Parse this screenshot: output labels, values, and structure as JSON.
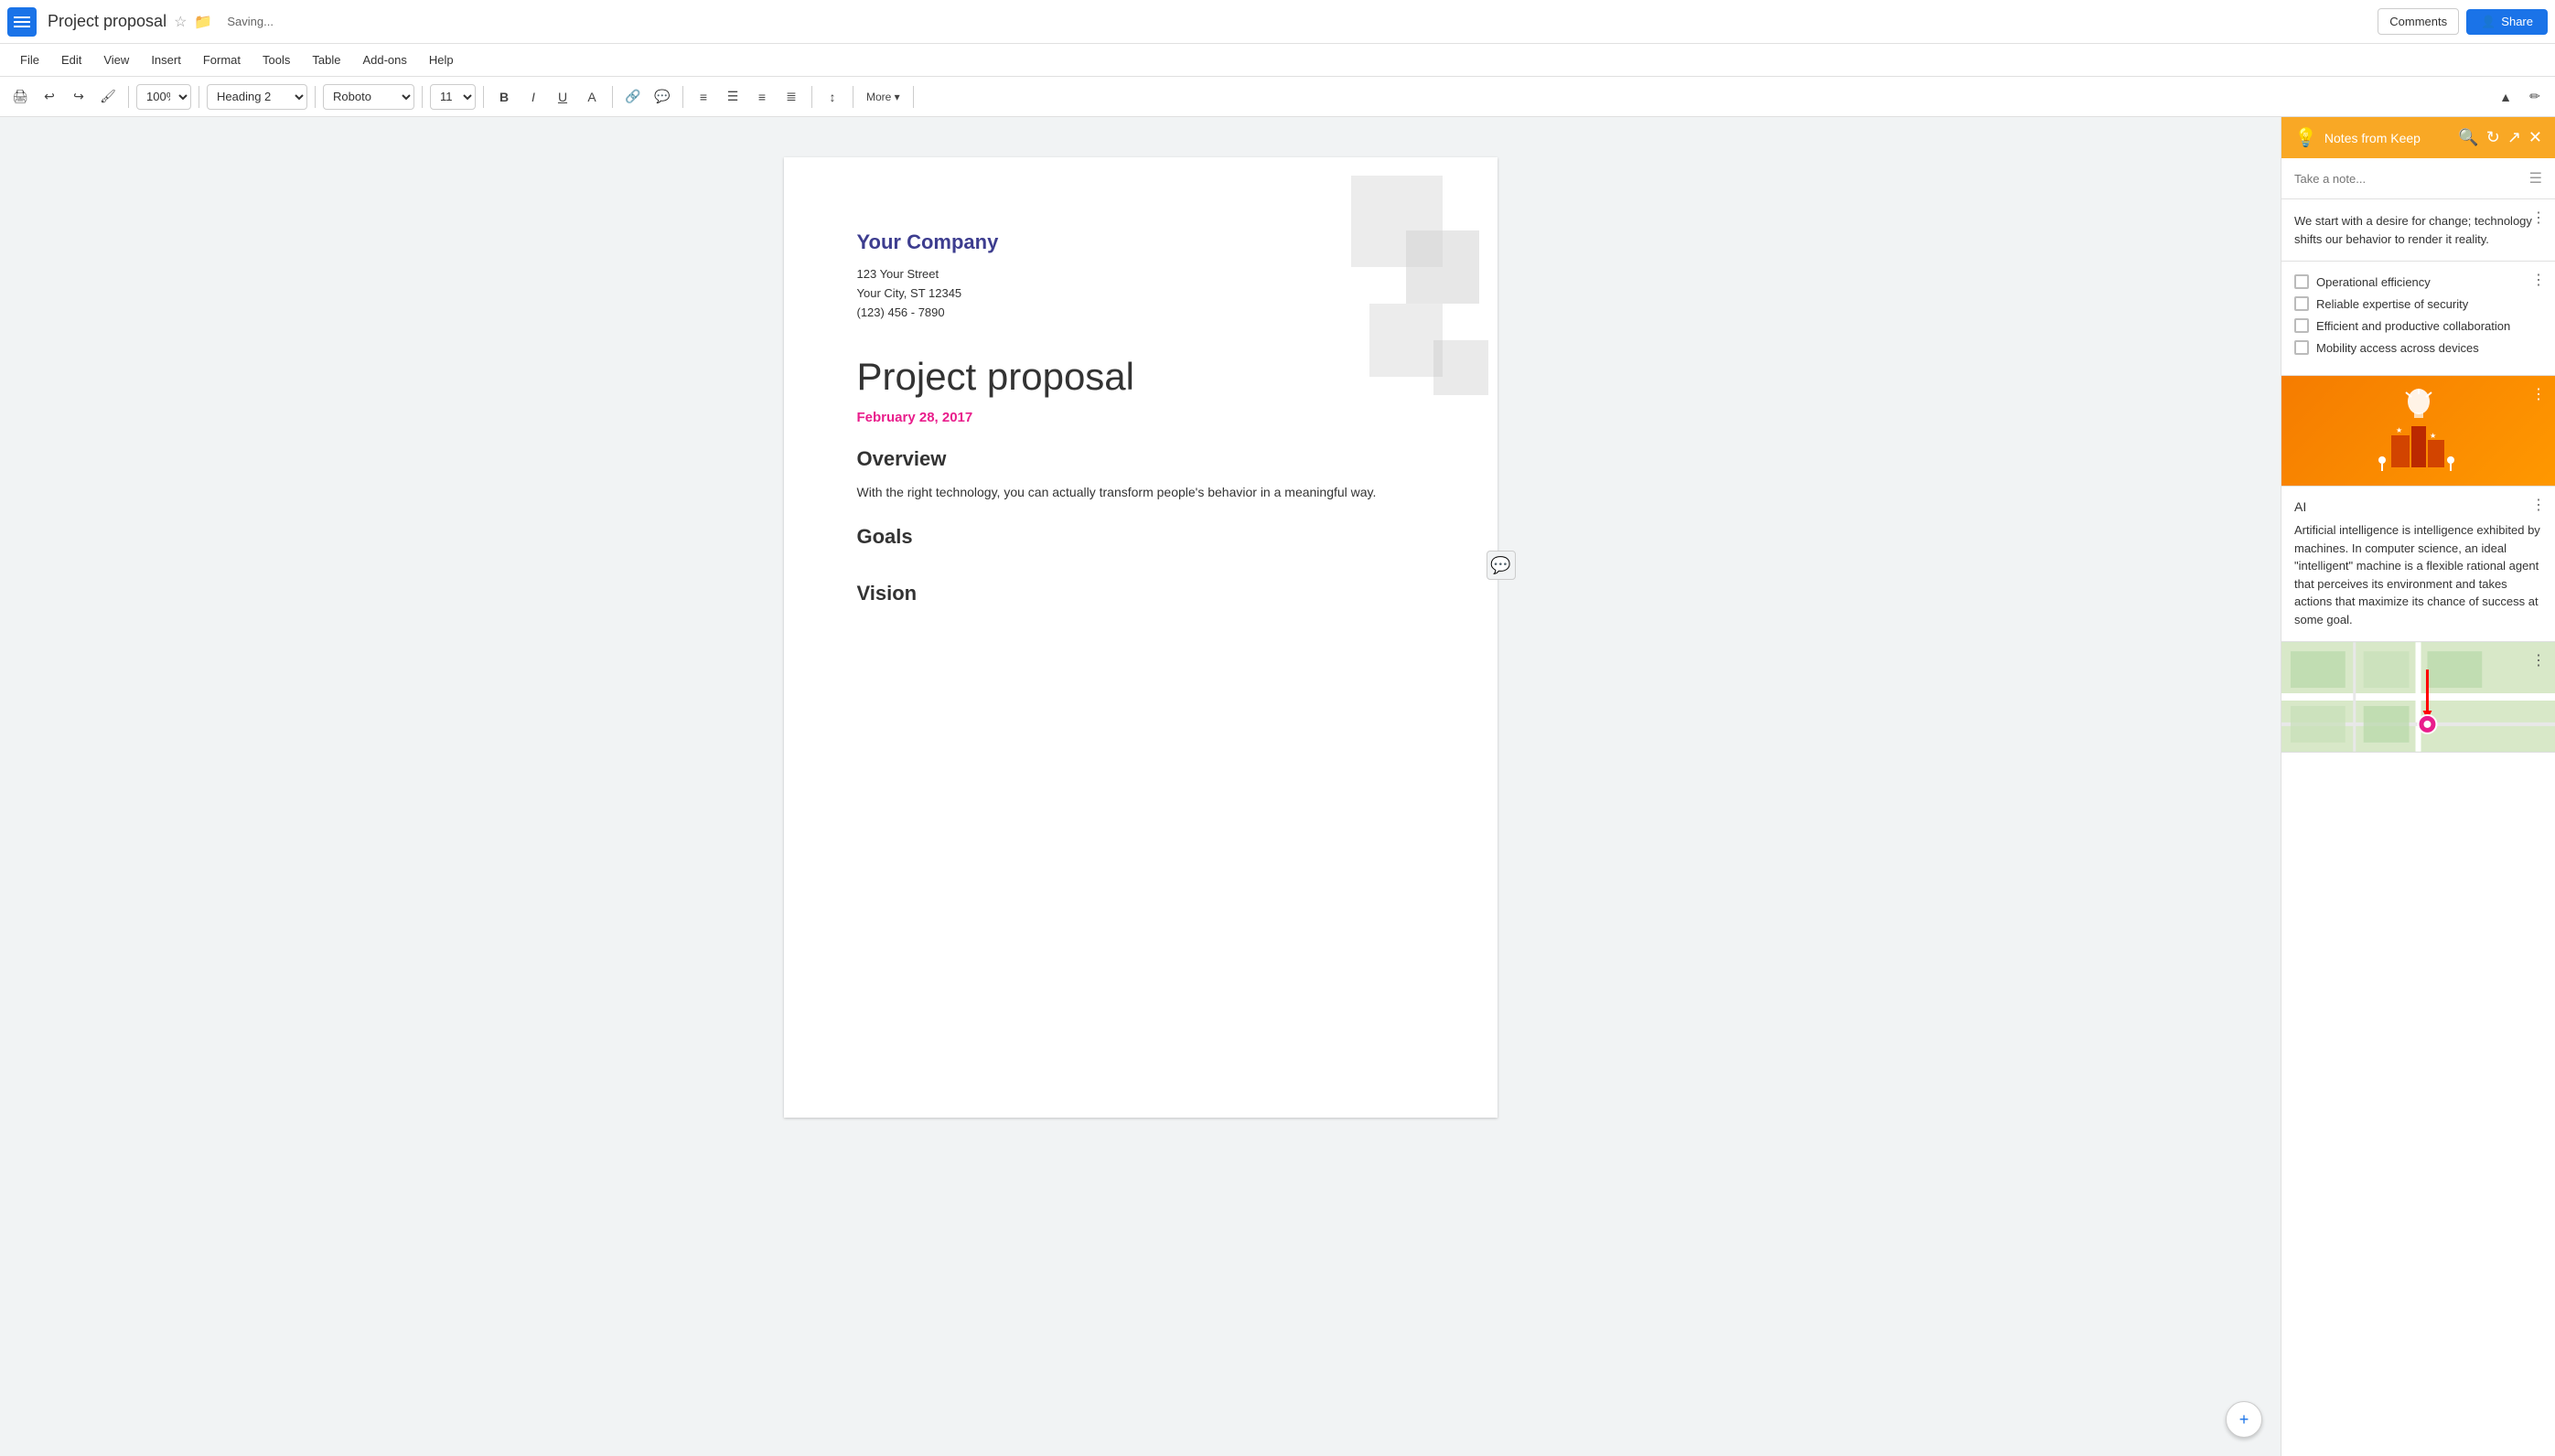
{
  "app": {
    "icon_label": "Google Apps",
    "title": "Project proposal",
    "saving": "Saving...",
    "comments_btn": "Comments",
    "share_btn": "Share"
  },
  "menu": {
    "items": [
      "File",
      "Edit",
      "View",
      "Insert",
      "Format",
      "Tools",
      "Table",
      "Add-ons",
      "Help"
    ]
  },
  "toolbar": {
    "zoom": "100%",
    "style": "Heading 2",
    "font": "Roboto",
    "size": "11",
    "more": "More"
  },
  "document": {
    "company": "Your Company",
    "address1": "123 Your Street",
    "address2": "Your City, ST 12345",
    "phone": "(123) 456 - 7890",
    "title": "Project proposal",
    "date": "February 28, 2017",
    "section1_heading": "Overview",
    "section1_text": "With the right technology, you can actually transform people's behavior in a meaningful way.",
    "section2_heading": "Goals",
    "section3_heading": "Vision"
  },
  "sidebar": {
    "title": "Notes from Keep",
    "note_placeholder": "Take a note...",
    "note1_text": "We start with a desire for change; technology shifts our behavior to render it reality.",
    "checklist_title": "",
    "checklist_items": [
      {
        "label": "Operational efficiency",
        "checked": false
      },
      {
        "label": "Reliable expertise of security",
        "checked": false
      },
      {
        "label": "Efficient and productive collaboration",
        "checked": false
      },
      {
        "label": "Mobility access across devices",
        "checked": false
      }
    ],
    "ai_title": "AI",
    "ai_text": "Artificial intelligence is intelligence exhibited by machines. In computer science, an ideal \"intelligent\" machine is a flexible rational agent that perceives its environment and takes actions that maximize its chance of success at some goal.",
    "more_options": "⋮",
    "search_title": "Search notes",
    "refresh_title": "Refresh",
    "open_title": "Open in Keep",
    "close_title": "Close"
  },
  "colors": {
    "brand_blue": "#1a73e8",
    "company_purple": "#3d3d8f",
    "date_pink": "#e91e8c",
    "keep_orange": "#f9a825",
    "share_blue": "#1a73e8"
  }
}
